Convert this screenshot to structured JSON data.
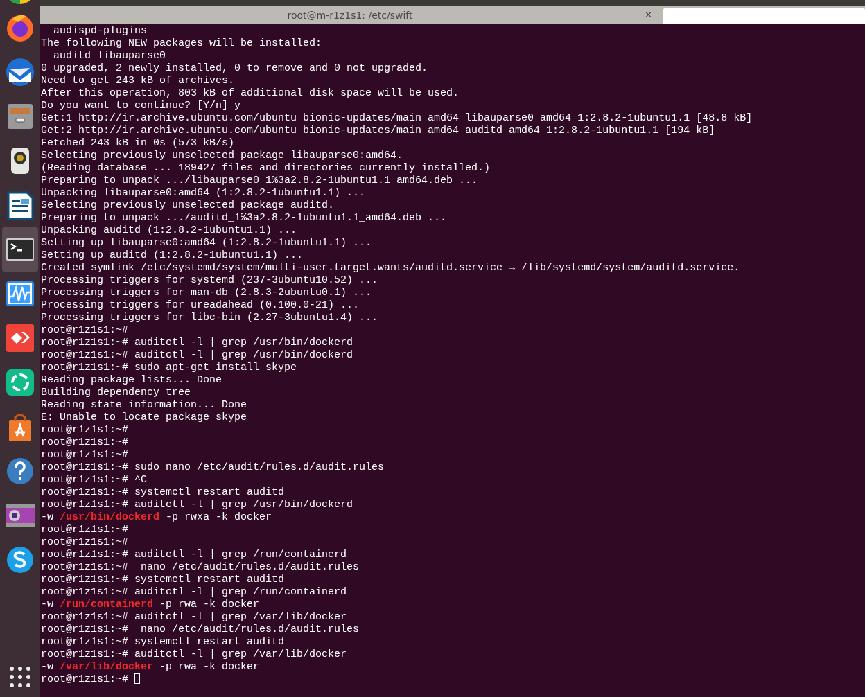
{
  "dock": {
    "items": [
      {
        "kind": "chrome",
        "selected": false
      },
      {
        "kind": "firefox",
        "selected": false
      },
      {
        "kind": "thunderbird",
        "selected": false
      },
      {
        "kind": "files",
        "selected": false
      },
      {
        "kind": "speaker",
        "selected": false
      },
      {
        "kind": "writer",
        "selected": false
      },
      {
        "kind": "terminal",
        "selected": true
      },
      {
        "kind": "monitor",
        "selected": false
      },
      {
        "kind": "anydesk",
        "selected": false
      },
      {
        "kind": "element",
        "selected": false
      },
      {
        "kind": "software",
        "selected": false
      },
      {
        "kind": "help",
        "selected": false
      },
      {
        "kind": "camera",
        "selected": false
      },
      {
        "kind": "skype",
        "selected": false
      }
    ],
    "apps_grid": true
  },
  "terminal": {
    "tab": {
      "title": "root@m-r1z1s1: /etc/swift",
      "close": "×"
    },
    "lines": [
      {
        "text": "  audispd-plugins"
      },
      {
        "text": "The following NEW packages will be installed:"
      },
      {
        "text": "  auditd libauparse0"
      },
      {
        "text": "0 upgraded, 2 newly installed, 0 to remove and 0 not upgraded."
      },
      {
        "text": "Need to get 243 kB of archives."
      },
      {
        "text": "After this operation, 803 kB of additional disk space will be used."
      },
      {
        "text": "Do you want to continue? [Y/n] y"
      },
      {
        "text": "Get:1 http://ir.archive.ubuntu.com/ubuntu bionic-updates/main amd64 libauparse0 amd64 1:2.8.2-1ubuntu1.1 [48.8 kB]"
      },
      {
        "text": "Get:2 http://ir.archive.ubuntu.com/ubuntu bionic-updates/main amd64 auditd amd64 1:2.8.2-1ubuntu1.1 [194 kB]"
      },
      {
        "text": "Fetched 243 kB in 0s (573 kB/s)"
      },
      {
        "text": "Selecting previously unselected package libauparse0:amd64."
      },
      {
        "text": "(Reading database ... 189427 files and directories currently installed.)"
      },
      {
        "text": "Preparing to unpack .../libauparse0_1%3a2.8.2-1ubuntu1.1_amd64.deb ..."
      },
      {
        "text": "Unpacking libauparse0:amd64 (1:2.8.2-1ubuntu1.1) ..."
      },
      {
        "text": "Selecting previously unselected package auditd."
      },
      {
        "text": "Preparing to unpack .../auditd_1%3a2.8.2-1ubuntu1.1_amd64.deb ..."
      },
      {
        "text": "Unpacking auditd (1:2.8.2-1ubuntu1.1) ..."
      },
      {
        "text": "Setting up libauparse0:amd64 (1:2.8.2-1ubuntu1.1) ..."
      },
      {
        "text": "Setting up auditd (1:2.8.2-1ubuntu1.1) ..."
      },
      {
        "text": "Created symlink /etc/systemd/system/multi-user.target.wants/auditd.service → /lib/systemd/system/auditd.service."
      },
      {
        "text": "Processing triggers for systemd (237-3ubuntu10.52) ..."
      },
      {
        "text": "Processing triggers for man-db (2.8.3-2ubuntu0.1) ..."
      },
      {
        "text": "Processing triggers for ureadahead (0.100.0-21) ..."
      },
      {
        "text": "Processing triggers for libc-bin (2.27-3ubuntu1.4) ..."
      },
      {
        "text": "root@r1z1s1:~#"
      },
      {
        "text": "root@r1z1s1:~# auditctl -l | grep /usr/bin/dockerd"
      },
      {
        "text": "root@r1z1s1:~# auditctl -l | grep /usr/bin/dockerd"
      },
      {
        "text": "root@r1z1s1:~# sudo apt-get install skype"
      },
      {
        "text": "Reading package lists... Done"
      },
      {
        "text": "Building dependency tree"
      },
      {
        "text": "Reading state information... Done"
      },
      {
        "text": "E: Unable to locate package skype"
      },
      {
        "text": "root@r1z1s1:~#"
      },
      {
        "text": "root@r1z1s1:~#"
      },
      {
        "text": "root@r1z1s1:~#"
      },
      {
        "text": "root@r1z1s1:~# sudo nano /etc/audit/rules.d/audit.rules"
      },
      {
        "text": "root@r1z1s1:~# ^C"
      },
      {
        "text": "root@r1z1s1:~# systemctl restart auditd"
      },
      {
        "text": "root@r1z1s1:~# auditctl -l | grep /usr/bin/dockerd"
      },
      {
        "segments": [
          {
            "text": "-w ",
            "kind": "plain"
          },
          {
            "text": "/usr/bin/dockerd",
            "kind": "match"
          },
          {
            "text": " -p rwxa -k docker",
            "kind": "plain"
          }
        ]
      },
      {
        "text": "root@r1z1s1:~#"
      },
      {
        "text": "root@r1z1s1:~#"
      },
      {
        "text": "root@r1z1s1:~# auditctl -l | grep /run/containerd"
      },
      {
        "text": "root@r1z1s1:~#  nano /etc/audit/rules.d/audit.rules"
      },
      {
        "text": "root@r1z1s1:~# systemctl restart auditd"
      },
      {
        "text": "root@r1z1s1:~# auditctl -l | grep /run/containerd"
      },
      {
        "segments": [
          {
            "text": "-w ",
            "kind": "plain"
          },
          {
            "text": "/run/containerd",
            "kind": "match"
          },
          {
            "text": " -p rwa -k docker",
            "kind": "plain"
          }
        ]
      },
      {
        "text": "root@r1z1s1:~# auditctl -l | grep /var/lib/docker"
      },
      {
        "text": "root@r1z1s1:~#  nano /etc/audit/rules.d/audit.rules"
      },
      {
        "text": "root@r1z1s1:~# systemctl restart auditd"
      },
      {
        "text": "root@r1z1s1:~# auditctl -l | grep /var/lib/docker"
      },
      {
        "segments": [
          {
            "text": "-w ",
            "kind": "plain"
          },
          {
            "text": "/var/lib/docker",
            "kind": "match"
          },
          {
            "text": " -p rwa -k docker",
            "kind": "plain"
          }
        ]
      },
      {
        "text": "root@r1z1s1:~# ",
        "cursor": true
      }
    ]
  }
}
